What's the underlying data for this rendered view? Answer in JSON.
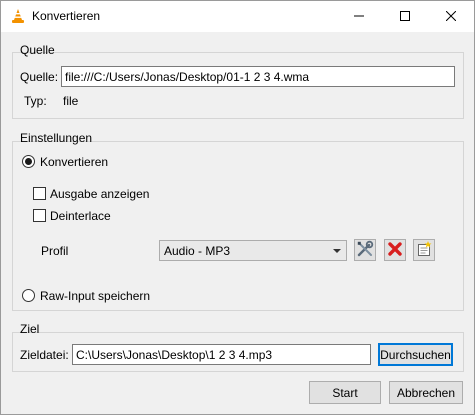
{
  "window": {
    "title": "Konvertieren",
    "title_icon": "vlc-cone-icon",
    "controls": [
      "minimize-icon",
      "maximize-icon",
      "close-icon"
    ]
  },
  "source": {
    "group_title": "Quelle",
    "source_label": "Quelle:",
    "source_value": "file:///C:/Users/Jonas/Desktop/01-1 2 3 4.wma",
    "type_label": "Typ:",
    "type_value": "file"
  },
  "settings": {
    "group_title": "Einstellungen",
    "convert_label": "Konvertieren",
    "convert_checked": true,
    "show_output_label": "Ausgabe anzeigen",
    "show_output_checked": false,
    "deinterlace_label": "Deinterlace",
    "deinterlace_checked": false,
    "profile_label": "Profil",
    "profile_value": "Audio - MP3",
    "raw_input_label": "Raw-Input speichern",
    "raw_input_checked": false
  },
  "destination": {
    "group_title": "Ziel",
    "file_label": "Zieldatei:",
    "file_value": "C:\\Users\\Jonas\\Desktop\\1 2 3 4.mp3",
    "browse_label": "Durchsuchen"
  },
  "footer": {
    "start_label": "Start",
    "cancel_label": "Abbrechen"
  },
  "colors": {
    "accent": "#0078d7",
    "delete_red": "#d81e1e",
    "vlc_orange": "#f39200"
  }
}
